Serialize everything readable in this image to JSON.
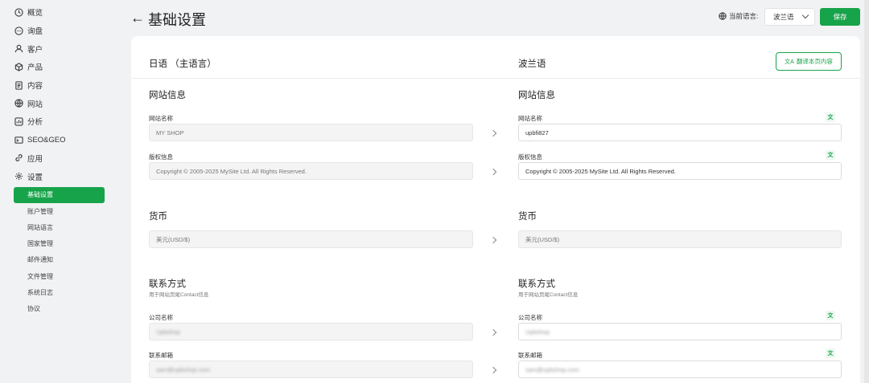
{
  "sidebar": {
    "items": [
      {
        "label": "概览",
        "icon": "clock-icon"
      },
      {
        "label": "询盘",
        "icon": "chat-icon"
      },
      {
        "label": "客户",
        "icon": "user-icon"
      },
      {
        "label": "产品",
        "icon": "box-icon"
      },
      {
        "label": "内容",
        "icon": "document-icon"
      },
      {
        "label": "网站",
        "icon": "globe-icon"
      },
      {
        "label": "分析",
        "icon": "chart-icon"
      },
      {
        "label": "SEO&GEO",
        "icon": "seo-icon"
      },
      {
        "label": "应用",
        "icon": "link-icon"
      },
      {
        "label": "设置",
        "icon": "gear-icon"
      }
    ],
    "sub_items": [
      {
        "label": "基础设置",
        "active": true
      },
      {
        "label": "账户管理"
      },
      {
        "label": "网站语言"
      },
      {
        "label": "国家管理"
      },
      {
        "label": "邮件通知"
      },
      {
        "label": "文件管理"
      },
      {
        "label": "系统日志"
      },
      {
        "label": "协议"
      }
    ]
  },
  "header": {
    "title": "基础设置",
    "current_lang_label": "当前语言:",
    "current_lang_value": "波兰语",
    "save_label": "保存"
  },
  "card": {
    "left_title": "日语 （主语言）",
    "right_title": "波兰语",
    "translate_button": "翻译本页内容",
    "sections": {
      "site_info": {
        "title": "网站信息",
        "name_label": "网站名称",
        "name_left": "MY SHOP",
        "name_right": "upbfi827",
        "copyright_label": "版权信息",
        "copyright_left": "Copyright © 2005-2025 MySite Ltd. All Rights Reserved.",
        "copyright_right": "Copyright © 2005-2025 MySite Ltd. All Rights Reserved."
      },
      "currency": {
        "title": "货币",
        "value_left": "美元(USD/$)",
        "value_right": "美元(USD/$)"
      },
      "contact": {
        "title": "联系方式",
        "subtitle": "用于网站页尾Contact信息",
        "company_label": "公司名称",
        "company_left": "Upbshop",
        "company_right": "Upbshop",
        "email_label": "联系邮箱",
        "email_left": "sam@upbshop.com",
        "email_right": "sam@upbshop.com"
      }
    },
    "translate_icon_glyph": "文A"
  },
  "colors": {
    "accent": "#17a34a",
    "background": "#f1f2f4"
  }
}
